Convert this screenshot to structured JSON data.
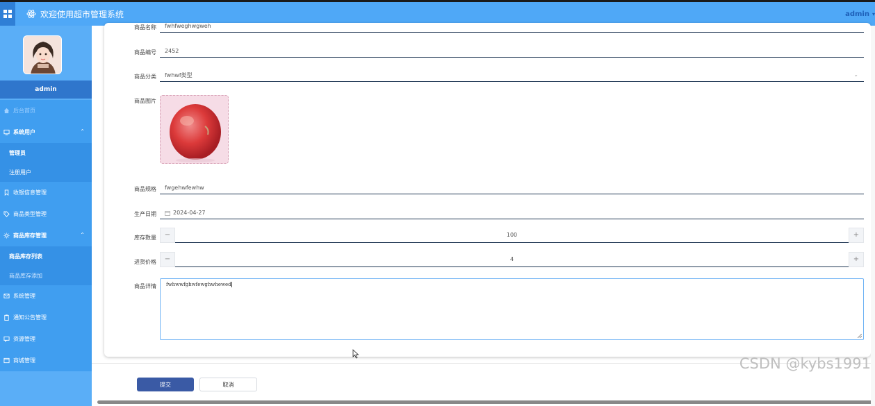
{
  "header": {
    "title": "欢迎使用超市管理系统",
    "user": "admin"
  },
  "sidebar": {
    "username": "admin",
    "items": [
      {
        "label": "后台首页"
      },
      {
        "label": "系统用户",
        "sub": [
          "管理员",
          "注册用户"
        ]
      },
      {
        "label": "收银信息管理"
      },
      {
        "label": "商品类型管理"
      },
      {
        "label": "商品库存管理",
        "sub": [
          "商品库存列表",
          "商品库存添加"
        ]
      },
      {
        "label": "系统管理"
      },
      {
        "label": "通知公告管理"
      },
      {
        "label": "资源管理"
      },
      {
        "label": "商城管理"
      }
    ]
  },
  "form": {
    "name_label": "商品名称",
    "name_value": "fwhfweghwgweh",
    "code_label": "商品编号",
    "code_value": "2452",
    "category_label": "商品分类",
    "category_value": "fwhwf类型",
    "image_label": "商品图片",
    "spec_label": "商品规格",
    "spec_value": "fwgehwfewhw",
    "date_label": "生产日期",
    "date_value": "2024-04-27",
    "stock_label": "库存数量",
    "stock_value": "100",
    "price_label": "进货价格",
    "price_value": "4",
    "detail_label": "商品详情",
    "detail_value": "fwhwwfghwfewghwhewed",
    "stepper_minus": "−",
    "stepper_plus": "+"
  },
  "actions": {
    "submit": "提交",
    "cancel": "取消"
  },
  "watermark": "CSDN @kybs1991",
  "colors": {
    "header": "#4fa8f7",
    "sidebar": "#409ef0",
    "submit": "#3a5aa5"
  }
}
